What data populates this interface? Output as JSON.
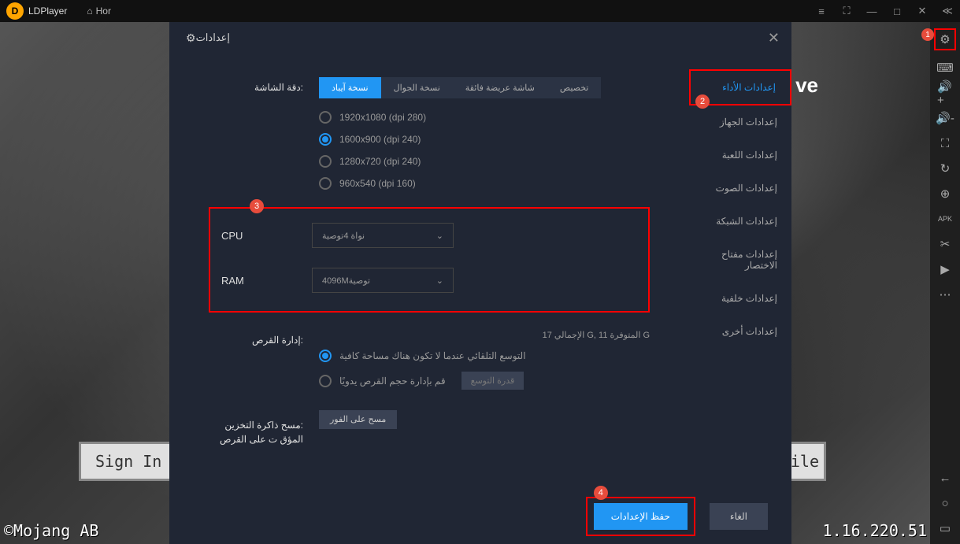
{
  "app_name": "LDPlayer",
  "home_tab": "Hor",
  "modal_title": "إعدادات",
  "nav": [
    {
      "label": "إعدادات الأداء",
      "active": true,
      "hl": true
    },
    {
      "label": "إعدادات الجهاز"
    },
    {
      "label": "إعدادات اللعبة"
    },
    {
      "label": "إعدادات الصوت"
    },
    {
      "label": "إعدادات الشبكة"
    },
    {
      "label": "إعدادات مفتاح الاختصار"
    },
    {
      "label": "إعدادات خلفية"
    },
    {
      "label": "إعدادات أخرى"
    }
  ],
  "resolution": {
    "label": ":دقة الشاشة",
    "tabs": [
      {
        "label": "نسخة آيباد",
        "active": true
      },
      {
        "label": "نسخة الجوال"
      },
      {
        "label": "شاشة عريضة فائقة"
      },
      {
        "label": "تخصيص"
      }
    ],
    "options": [
      {
        "text": "1920x1080  (dpi 280)"
      },
      {
        "text": "1600x900  (dpi 240)",
        "checked": true
      },
      {
        "text": "1280x720  (dpi 240)"
      },
      {
        "text": "960x540  (dpi 160)"
      }
    ]
  },
  "cpu": {
    "label": "CPU",
    "value": "نواة 4توصية"
  },
  "ram": {
    "label": "RAM",
    "value": "توصية4096M"
  },
  "disk": {
    "label": ":إدارة القرص",
    "info": "G المتوفرة G, 11 الإجمالي 17",
    "auto": "التوسع التلقائي عندما لا تكون هناك مساحة كافية",
    "manual": "قم بإدارة حجم القرص يدويًا",
    "expand_btn": "قدرة التوسع"
  },
  "cache": {
    "label": ":مسح ذاكرة التخزين المؤق ت على القرص",
    "btn": "مسح على الفور"
  },
  "save_btn": "حفظ الإعدادات",
  "cancel_btn": "الغاء",
  "badges": {
    "b1": "1",
    "b2": "2",
    "b3": "3",
    "b4": "4"
  },
  "game": {
    "sign_in": "Sign In",
    "file": "ile",
    "mojang": "©Mojang AB",
    "version": "1.16.220.51",
    "hl": "ve"
  }
}
